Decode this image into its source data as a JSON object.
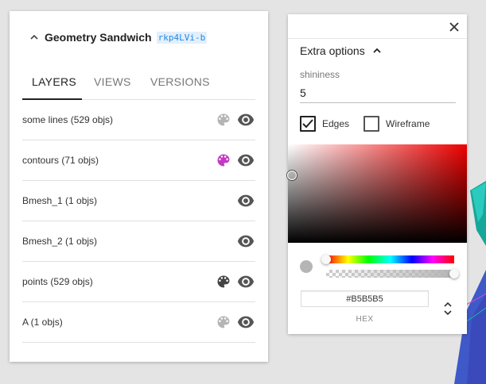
{
  "stream": {
    "name": "Geometry Sandwich",
    "id": "rkp4LVi-b"
  },
  "tabs": [
    {
      "label": "LAYERS",
      "active": true
    },
    {
      "label": "VIEWS",
      "active": false
    },
    {
      "label": "VERSIONS",
      "active": false
    }
  ],
  "layers": [
    {
      "name": "some lines (529 objs)",
      "palette_color": "#b5b5b5",
      "visible": true
    },
    {
      "name": "contours (71 objs)",
      "palette_color": "#c23bc4",
      "visible": true
    },
    {
      "name": "Bmesh_1 (1 objs)",
      "palette_color": null,
      "visible": true
    },
    {
      "name": "Bmesh_2 (1 objs)",
      "palette_color": null,
      "visible": true
    },
    {
      "name": "points (529 objs)",
      "palette_color": "#444444",
      "visible": true
    },
    {
      "name": "A (1 objs)",
      "palette_color": "#b5b5b5",
      "visible": true
    }
  ],
  "extra_options": {
    "title": "Extra options",
    "shininess_label": "shininess",
    "shininess_value": "5",
    "edges_label": "Edges",
    "edges_checked": true,
    "wireframe_label": "Wireframe",
    "wireframe_checked": false
  },
  "color_picker": {
    "hex_value": "#B5B5B5",
    "hex_label": "HEX",
    "hue_position": 0.0,
    "alpha_position": 1.0,
    "current_color": "#b5b5b5"
  },
  "colors": {
    "accent_id": "#1e88e5",
    "tab_active": "#222222",
    "icon_gray": "#555555"
  }
}
